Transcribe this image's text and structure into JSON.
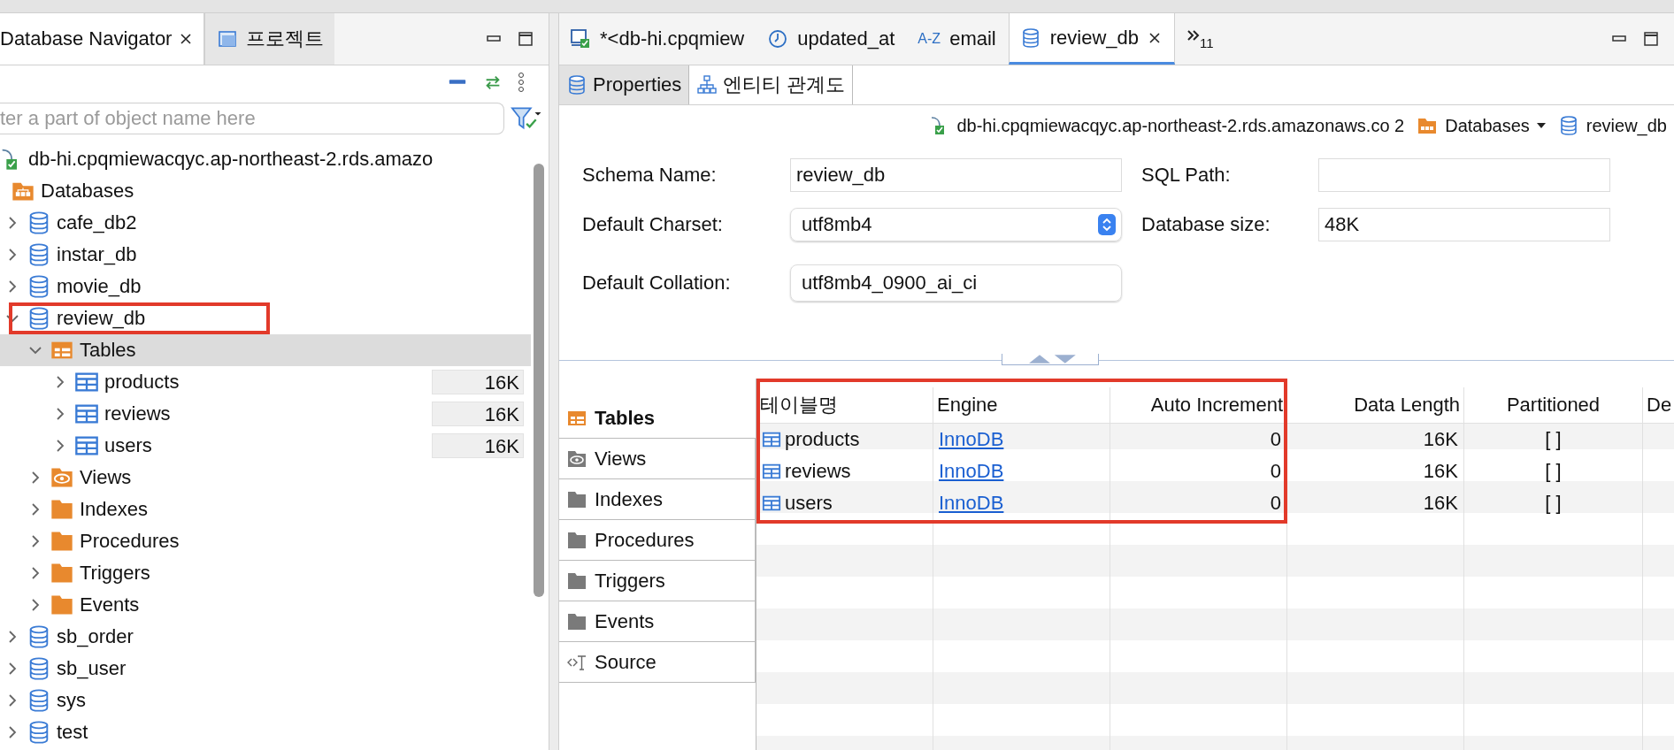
{
  "navigator": {
    "tabs": [
      {
        "label": "Database Navigator",
        "kind": "plain",
        "closable": true,
        "selected": true
      },
      {
        "label": "프로젝트",
        "kind": "project",
        "closable": false,
        "selected": false
      }
    ],
    "search": {
      "placeholder": "ter a part of object name here"
    },
    "tree": [
      {
        "label": "db-hi.cpqmiewacqyc.ap-northeast-2.rds.amazo",
        "kind": "connection",
        "selected": false,
        "highlighted": false,
        "children": [
          {
            "label": "Databases",
            "kind": "databases",
            "selected": false,
            "highlighted": false,
            "children": [
              {
                "label": "cafe_db2",
                "kind": "database",
                "expanded": false,
                "selected": false,
                "highlighted": false
              },
              {
                "label": "instar_db",
                "kind": "database",
                "expanded": false,
                "selected": false,
                "highlighted": false
              },
              {
                "label": "movie_db",
                "kind": "database",
                "expanded": false,
                "selected": false,
                "highlighted": false
              },
              {
                "label": "review_db",
                "kind": "database",
                "expanded": true,
                "selected": false,
                "highlighted": true,
                "children": [
                  {
                    "label": "Tables",
                    "kind": "tables",
                    "expanded": true,
                    "selected": true,
                    "highlighted": false,
                    "children": [
                      {
                        "label": "products",
                        "kind": "table",
                        "size": "16K",
                        "expanded": false,
                        "selected": false,
                        "highlighted": false
                      },
                      {
                        "label": "reviews",
                        "kind": "table",
                        "size": "16K",
                        "expanded": false,
                        "selected": false,
                        "highlighted": false
                      },
                      {
                        "label": "users",
                        "kind": "table",
                        "size": "16K",
                        "expanded": false,
                        "selected": false,
                        "highlighted": false
                      }
                    ]
                  },
                  {
                    "label": "Views",
                    "kind": "views",
                    "expanded": false,
                    "selected": false,
                    "highlighted": false
                  },
                  {
                    "label": "Indexes",
                    "kind": "folder",
                    "expanded": false,
                    "selected": false,
                    "highlighted": false
                  },
                  {
                    "label": "Procedures",
                    "kind": "folder",
                    "expanded": false,
                    "selected": false,
                    "highlighted": false
                  },
                  {
                    "label": "Triggers",
                    "kind": "folder",
                    "expanded": false,
                    "selected": false,
                    "highlighted": false
                  },
                  {
                    "label": "Events",
                    "kind": "folder",
                    "expanded": false,
                    "selected": false,
                    "highlighted": false
                  }
                ]
              },
              {
                "label": "sb_order",
                "kind": "database",
                "expanded": false,
                "selected": false,
                "highlighted": false
              },
              {
                "label": "sb_user",
                "kind": "database",
                "expanded": false,
                "selected": false,
                "highlighted": false
              },
              {
                "label": "sys",
                "kind": "database",
                "expanded": false,
                "selected": false,
                "highlighted": false
              },
              {
                "label": "test",
                "kind": "database",
                "expanded": false,
                "selected": false,
                "highlighted": false
              }
            ]
          }
        ]
      }
    ]
  },
  "editor": {
    "tabs": [
      {
        "label": "*<db-hi.cpqmiew",
        "kind": "connection",
        "closable": false,
        "selected": false
      },
      {
        "label": "updated_at",
        "kind": "clock",
        "closable": false,
        "selected": false
      },
      {
        "label": "email",
        "kind": "text",
        "icon_text": "A-Z",
        "closable": false,
        "selected": false
      },
      {
        "label": "review_db",
        "kind": "database",
        "closable": true,
        "selected": true
      }
    ],
    "overflow": "11",
    "subtabs": [
      {
        "label": "Properties",
        "kind": "database",
        "selected": true
      },
      {
        "label": "엔티티 관계도",
        "kind": "diagram",
        "selected": false
      }
    ],
    "breadcrumb": [
      {
        "label": "db-hi.cpqmiewacqyc.ap-northeast-2.rds.amazonaws.co 2",
        "kind": "connection",
        "dropdown": false
      },
      {
        "label": "Databases",
        "kind": "databases",
        "dropdown": true
      },
      {
        "label": "review_db",
        "kind": "database",
        "dropdown": false
      }
    ],
    "form_left": [
      {
        "label": "Schema Name:",
        "value": "review_db",
        "kind": "text"
      },
      {
        "label": "Default Charset:",
        "value": "utf8mb4",
        "kind": "select"
      },
      {
        "label": "Default Collation:",
        "value": "utf8mb4_0900_ai_ci",
        "kind": "combo"
      }
    ],
    "form_right": [
      {
        "label": "SQL Path:"
      },
      {
        "label": "Database size:",
        "value": "48K"
      }
    ],
    "sections": [
      {
        "label": "Tables",
        "kind": "tables",
        "selected": true
      },
      {
        "label": "Views",
        "kind": "views",
        "selected": false
      },
      {
        "label": "Indexes",
        "kind": "folder",
        "selected": false
      },
      {
        "label": "Procedures",
        "kind": "folder",
        "selected": false
      },
      {
        "label": "Triggers",
        "kind": "folder",
        "selected": false
      },
      {
        "label": "Events",
        "kind": "folder",
        "selected": false
      },
      {
        "label": "Source",
        "kind": "source",
        "selected": false
      }
    ],
    "table": {
      "columns": [
        {
          "label": "테이블명",
          "highlighted": true
        },
        {
          "label": "Engine",
          "highlighted": true
        },
        {
          "label": "Auto Increment",
          "highlighted": true
        },
        {
          "label": "Data Length",
          "highlighted": false
        },
        {
          "label": "Partitioned",
          "highlighted": false
        },
        {
          "label": "De",
          "highlighted": false
        }
      ],
      "rows": [
        {
          "cells": [
            "products",
            "InnoDB",
            "0",
            "16K",
            "[ ]"
          ]
        },
        {
          "cells": [
            "reviews",
            "InnoDB",
            "0",
            "16K",
            "[ ]"
          ]
        },
        {
          "cells": [
            "users",
            "InnoDB",
            "0",
            "16K",
            "[ ]"
          ]
        }
      ]
    }
  }
}
